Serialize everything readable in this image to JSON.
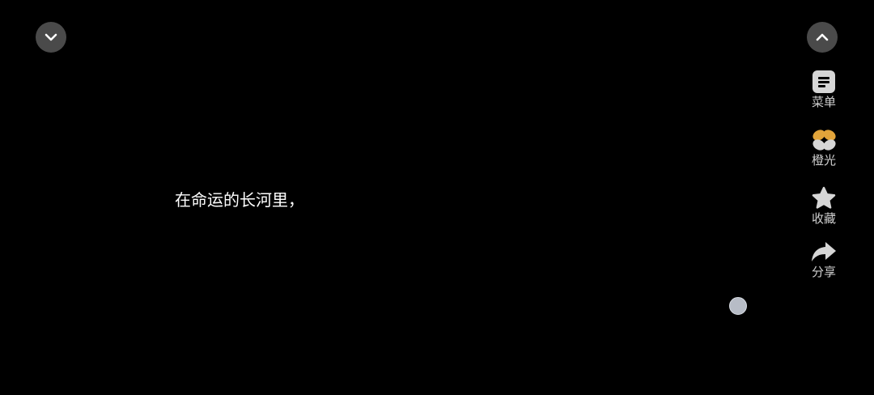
{
  "player": {
    "subtitle": "在命运的长河里，"
  },
  "controls": {
    "collapse_icon": "chevron-down-icon",
    "expand_icon": "chevron-up-icon"
  },
  "side_menu": {
    "items": [
      {
        "label": "菜单",
        "icon": "menu-list-icon"
      },
      {
        "label": "橙光",
        "icon": "orange-light-logo-icon"
      },
      {
        "label": "收藏",
        "icon": "star-icon"
      },
      {
        "label": "分享",
        "icon": "share-arrow-icon"
      }
    ]
  },
  "colors": {
    "background": "#000000",
    "button_bg": "#4a4a4a",
    "accent_orange": "#e2a43a",
    "label_gray": "#cfcfcf",
    "float_dot": "#b7bcc6"
  }
}
